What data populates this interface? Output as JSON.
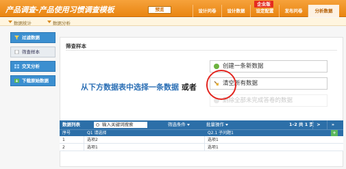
{
  "app": {
    "title": "产品调查-产品使用习惯调查模板"
  },
  "header": {
    "preview_label": "预览",
    "enterprise_badge": "企业版",
    "nav": [
      {
        "label": "设计问卷"
      },
      {
        "label": "设计数据"
      },
      {
        "label": "设定配置"
      },
      {
        "label": "发布问卷"
      },
      {
        "label": "分析数据"
      }
    ]
  },
  "subnav": {
    "items": [
      {
        "label": "数据统计"
      },
      {
        "label": "数据分析"
      }
    ]
  },
  "sidebar": {
    "items": [
      {
        "label": "过滤数据",
        "icon": "funnel-icon"
      },
      {
        "label": "筛查样本",
        "icon": "document-icon"
      },
      {
        "label": "交叉分析",
        "icon": "cross-analysis-icon"
      },
      {
        "label": "下载原始数据",
        "icon": "download-icon"
      }
    ]
  },
  "main": {
    "title": "筛查样本",
    "instruction_main": "从下方数据表中选择一条数据",
    "instruction_or": "或者",
    "options": {
      "create": "创建一条新数据",
      "clear": "清空所有数据",
      "delete": "删除全部未完成答卷的数据"
    }
  },
  "list": {
    "title": "数据列表",
    "search_placeholder": "输入关键词搜索",
    "filter_label": "筛选条件",
    "batch_label": "批量操作",
    "pagination": "1-2 共 1 页",
    "next": ">",
    "last": "»",
    "add": "+",
    "columns": {
      "index": "序号",
      "q1": "Q1 请选择",
      "q2": "Q2.1 子问题1"
    },
    "rows": [
      {
        "index": "1",
        "q1": "选项2",
        "q2": "选项1"
      },
      {
        "index": "2",
        "q1": "选项1",
        "q2": "选项1"
      }
    ]
  },
  "colors": {
    "header": "#f39a2e",
    "accent": "#2c6fa8",
    "highlight": "#e3251f"
  }
}
